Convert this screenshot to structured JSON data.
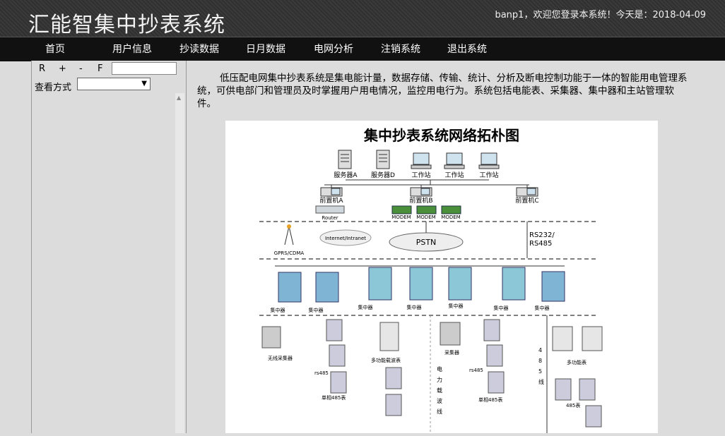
{
  "header": {
    "title": "汇能智集中抄表系统",
    "welcome": "banp1，欢迎您登录本系统！今天是：2018-04-09"
  },
  "nav": {
    "items": [
      "首页",
      "用户信息",
      "抄读数据",
      "日月数据",
      "电网分析",
      "注销系统",
      "退出系统"
    ]
  },
  "sidebar": {
    "zoom_buttons": [
      "R",
      "+",
      "-",
      "F"
    ],
    "zoom_value": "",
    "view_label": "查看方式",
    "view_selected": ""
  },
  "main": {
    "intro": "低压配电网集中抄表系统是集电能计量，数据存储、传输、统计、分析及断电控制功能于一体的智能用电管理系统，可供电部门和管理员及时掌握用户用电情况，监控用电行为。系统包括电能表、采集器、集中器和主站管理软件。"
  },
  "diagram": {
    "title": "集中抄表系统网络拓朴图",
    "servers": [
      "服务器A",
      "服务器D"
    ],
    "workstations": [
      "工作站",
      "工作站",
      "工作站"
    ],
    "front_ends": [
      "前置机A",
      "前置机B",
      "前置机C"
    ],
    "router": "Router",
    "modems": [
      "MODEM",
      "MODEM",
      "MODEM"
    ],
    "internet": "Internet/Intranet",
    "gprs": "GPRS/CDMA",
    "pstn": "PSTN",
    "rs": [
      "RS232/",
      "RS485"
    ],
    "concentrator": "集中器",
    "wireless_collector": "无线采集器",
    "multi_carrier_meter": "多功能载波表",
    "collector": "采集器",
    "rs485_a": "rs485",
    "rs485_b": "rs485",
    "single_485_a": "单相485表",
    "single_485_b": "单相485表",
    "power_carrier": [
      "电",
      "力",
      "载",
      "波",
      "线"
    ],
    "line_485": [
      "4",
      "8",
      "5",
      "线"
    ],
    "multi_meter": "多功能表",
    "meter_485": "485表"
  }
}
